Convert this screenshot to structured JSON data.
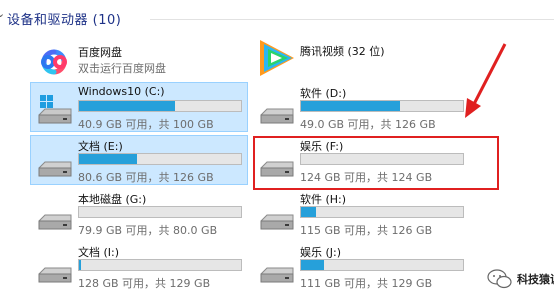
{
  "group": {
    "title": "设备和驱动器 (10)"
  },
  "apps": [
    {
      "name": "百度网盘",
      "sub": "双击运行百度网盘"
    },
    {
      "name": "腾讯视频 (32 位)",
      "sub": ""
    }
  ],
  "drives": [
    {
      "name": "Windows10 (C:)",
      "info": "40.9 GB 可用，共 100 GB",
      "used": 0.59,
      "selected": true,
      "os": true
    },
    {
      "name": "软件 (D:)",
      "info": "49.0 GB 可用，共 126 GB",
      "used": 0.61,
      "selected": false
    },
    {
      "name": "文档 (E:)",
      "info": "80.6 GB 可用，共 126 GB",
      "used": 0.36,
      "selected": true
    },
    {
      "name": "娱乐 (F:)",
      "info": "124 GB 可用，共 124 GB",
      "used": 0.0,
      "selected": false
    },
    {
      "name": "本地磁盘 (G:)",
      "info": "79.9 GB 可用，共 80.0 GB",
      "used": 0.0,
      "selected": false
    },
    {
      "name": "软件 (H:)",
      "info": "115 GB 可用，共 126 GB",
      "used": 0.09,
      "selected": false
    },
    {
      "name": "文档 (I:)",
      "info": "128 GB 可用，共 129 GB",
      "used": 0.01,
      "selected": false
    },
    {
      "name": "娱乐 (J:)",
      "info": "111 GB 可用，共 129 GB",
      "used": 0.14,
      "selected": false
    }
  ],
  "colors": {
    "bar_fill": "#26a0da",
    "selection": "#cce8ff",
    "highlight": "#e02020"
  },
  "watermark": {
    "text": "科技猿说"
  }
}
